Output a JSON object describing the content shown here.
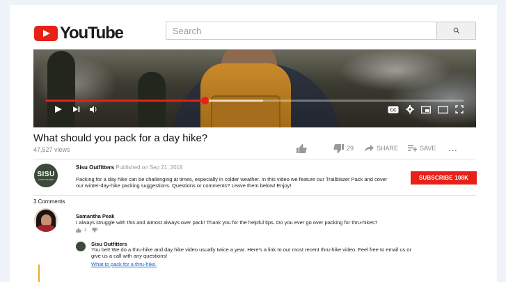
{
  "header": {
    "logo_text": "YouTube",
    "search_placeholder": "Search"
  },
  "player": {
    "progress_played": 0.38,
    "progress_buffered": 0.52,
    "cc_label": "CC"
  },
  "video": {
    "title": "What should you pack for a day hike?",
    "views": "47,527 views",
    "dislike_count": "29",
    "share_label": "SHARE",
    "save_label": "SAVE",
    "more_label": "..."
  },
  "channel": {
    "logo_text": "SISU",
    "logo_subtext": "OUTFITTERS",
    "name": "Sisu Outfitters",
    "published": "Published on Sep 21, 2018",
    "description": "Packing for a day hike can be challenging at times, especially in colder weather. In this video we feature our Trailblazer Pack and cover our winter-day-hike packing suggestions. Questions or comments? Leave them below! Enjoy!",
    "subscribe_label": "SUBSCRIBE 108K"
  },
  "comments": {
    "count_label": "3 Comments",
    "items": [
      {
        "author": "Samantha Peak",
        "text": "I always struggle with this and almost always over pack! Thank you for the helpful tips. Do you ever go over packing for thru-hikes?",
        "likes": "1"
      }
    ],
    "reply": {
      "author": "Sisu Outfitters",
      "text": "You bet! We do a thru-hike and day hike video usually twice a year. Here's a link to our most recent thru-hike video. Feel free to email us or give us a call with any questions!",
      "link_text": "What to pack for a thru-hike."
    }
  },
  "colors": {
    "brand_red": "#e62117",
    "link_blue": "#1a5fcc"
  }
}
